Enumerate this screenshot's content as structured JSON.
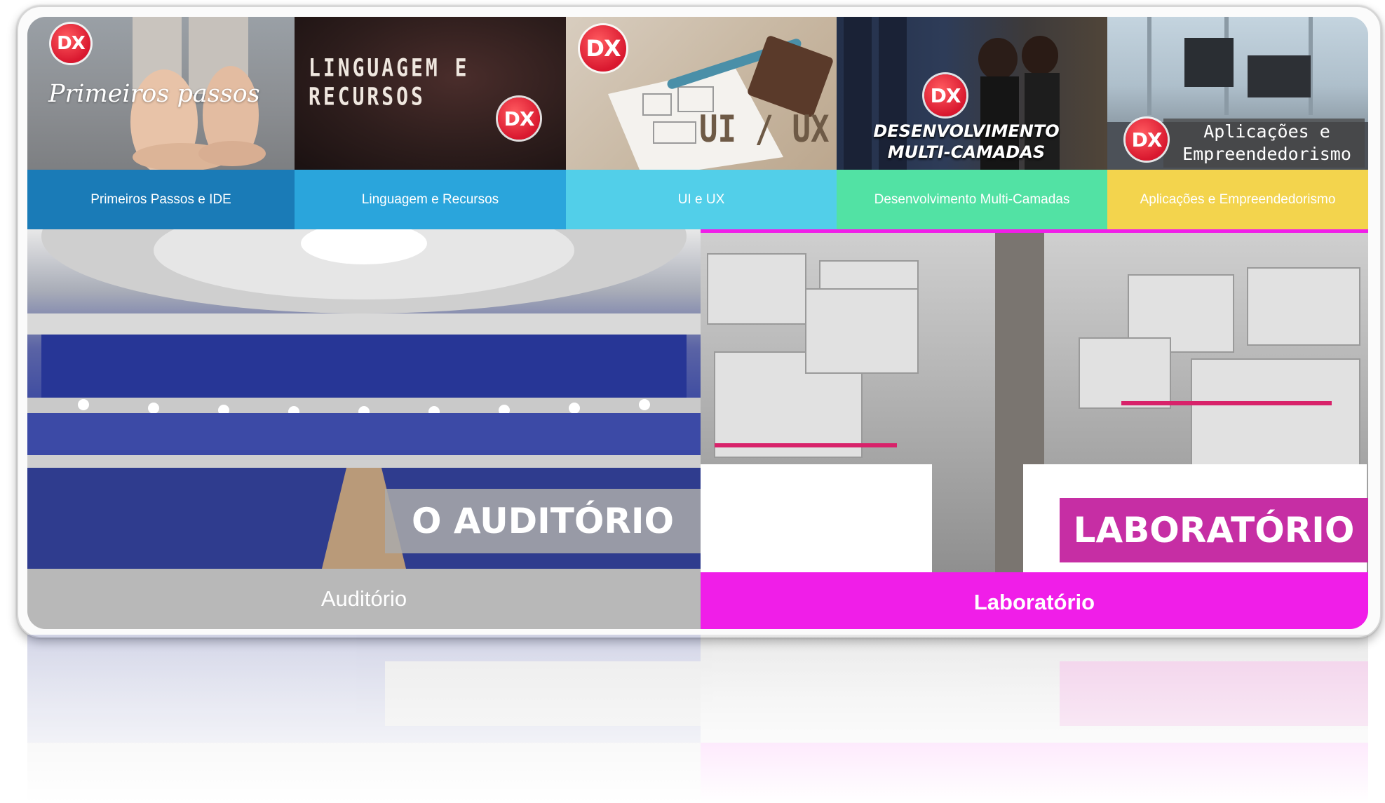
{
  "categories": [
    {
      "id": "primeiros",
      "image_title": "Primeiros passos",
      "label": "Primeiros Passos e IDE",
      "badge": "DX",
      "bar_color": "#1a7bb7"
    },
    {
      "id": "linguagem",
      "image_title": "LINGUAGEM E RECURSOS",
      "label": "Linguagem e Recursos",
      "badge": "DX",
      "bar_color": "#2aa5dc"
    },
    {
      "id": "uiux",
      "image_title": "UI / UX",
      "label": "UI e UX",
      "badge": "DX",
      "bar_color": "#52cfe9"
    },
    {
      "id": "multicamadas",
      "image_title_line1": "DESENVOLVIMENTO",
      "image_title_line2": "MULTI-CAMADAS",
      "label": "Desenvolvimento Multi-Camadas",
      "badge": "DX",
      "bar_color": "#52e2a4"
    },
    {
      "id": "aplicacoes",
      "image_title_line1": "Aplicações e",
      "image_title_line2": "Empreendedorismo",
      "label": "Aplicações e Empreendedorismo",
      "badge": "DX",
      "bar_color": "#f3d44d"
    }
  ],
  "auditorio": {
    "image_title": "O AUDITÓRIO",
    "label": "Auditório",
    "bar_color": "#b8b8b8"
  },
  "laboratorio": {
    "image_title": "LABORATÓRIO",
    "label": "Laboratório",
    "bar_color": "#f01ee8",
    "accent": "#c62ea4"
  }
}
